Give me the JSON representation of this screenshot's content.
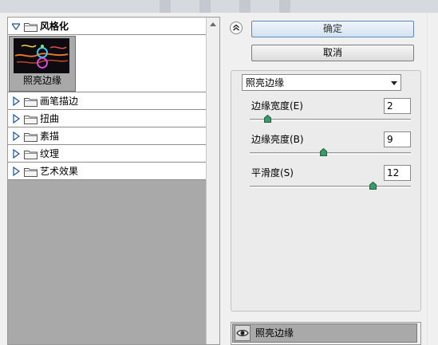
{
  "filter_tree": {
    "expanded_category": {
      "label": "风格化"
    },
    "selected_thumbnail": {
      "label": "照亮边缘"
    },
    "collapsed_categories": [
      {
        "label": "画笔描边"
      },
      {
        "label": "扭曲"
      },
      {
        "label": "素描"
      },
      {
        "label": "纹理"
      },
      {
        "label": "艺术效果"
      }
    ]
  },
  "buttons": {
    "ok_label": "确定",
    "cancel_label": "取消"
  },
  "filter_select": {
    "selected": "照亮边缘"
  },
  "parameters": [
    {
      "label": "边缘宽度(E)",
      "value": "2",
      "min": 1,
      "max": 14
    },
    {
      "label": "边缘亮度(B)",
      "value": "9",
      "min": 0,
      "max": 20
    },
    {
      "label": "平滑度(S)",
      "value": "12",
      "min": 1,
      "max": 15
    }
  ],
  "effect_layers": [
    {
      "name": "照亮边缘",
      "visible": true
    }
  ],
  "colors": {
    "panel_gray": "#a9a9a9",
    "ok_button_border": "#5e87b5",
    "slider_thumb": "#3a9a6a"
  },
  "icons": {
    "expand_arrow": "triangle-right-icon",
    "collapse_arrow": "triangle-down-icon",
    "folder": "folder-icon",
    "visibility": "eye-icon",
    "collapse_toggle": "double-chevron-up-icon"
  }
}
